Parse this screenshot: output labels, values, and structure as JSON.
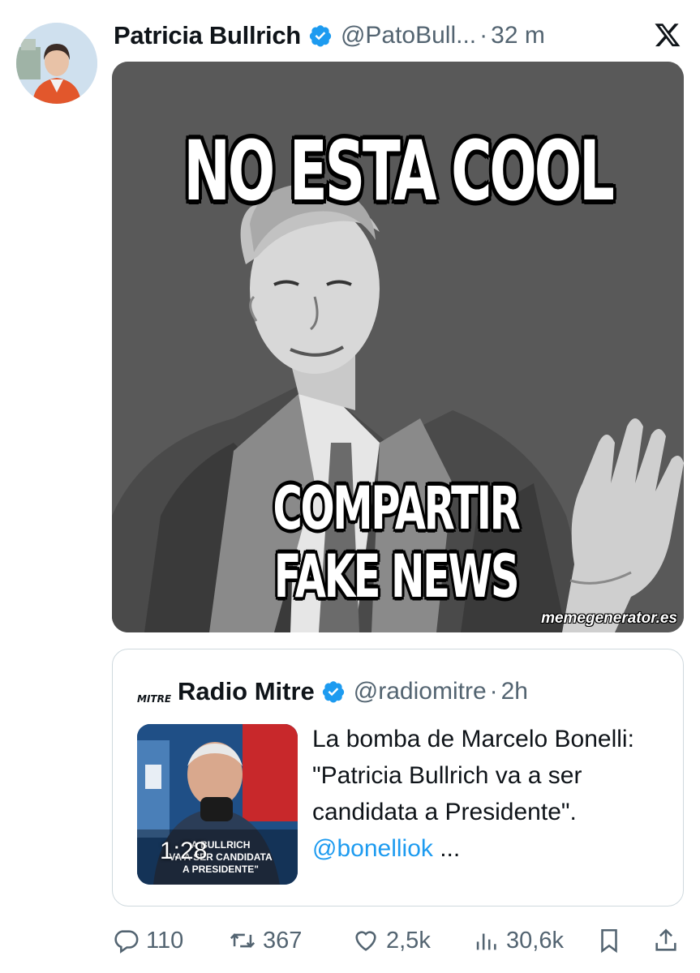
{
  "tweet": {
    "author": {
      "name": "Patricia Bullrich",
      "handle": "@PatoBull...",
      "separator": "·",
      "time": "32 m"
    },
    "meme": {
      "top_text": "NO ESTA COOL",
      "bottom_line_1": "COMPARTIR",
      "bottom_line_2": "FAKE NEWS",
      "watermark": "memegenerator.es"
    },
    "quoted": {
      "logo_text": "MITRE",
      "name": "Radio Mitre",
      "handle": "@radiomitre",
      "separator": "·",
      "time": "2h",
      "video_duration": "1:28",
      "thumb_caption_1": "A BULLRICH",
      "thumb_caption_2": "VA A SER CANDIDATA",
      "thumb_caption_3": "A PRESIDENTE\"",
      "text": "La bomba de Marcelo Bonelli: \"Patricia Bullrich va a ser candidata a Presidente\". ",
      "mention": "@bonelliok",
      "ellipsis": " ..."
    },
    "actions": {
      "replies": "110",
      "reposts": "367",
      "likes": "2,5k",
      "views": "30,6k"
    }
  },
  "colors": {
    "verified": "#1d9bf0",
    "link": "#1d9bf0",
    "muted": "#536471"
  },
  "icons": [
    "verified-badge-icon",
    "x-logo-icon",
    "reply-icon",
    "repost-icon",
    "like-icon",
    "views-icon",
    "bookmark-icon",
    "share-icon"
  ]
}
